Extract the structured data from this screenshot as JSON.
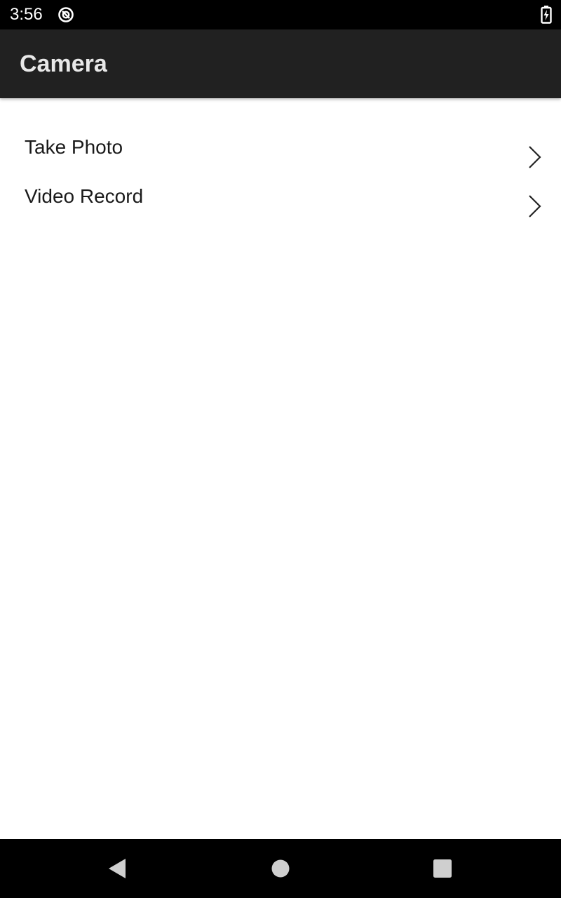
{
  "status_bar": {
    "time": "3:56",
    "icons": [
      "sync-icon",
      "battery-charging-icon"
    ]
  },
  "app_bar": {
    "title": "Camera",
    "background": "#212121"
  },
  "list": {
    "items": [
      {
        "label": "Take Photo",
        "icon": "chevron-right-icon"
      },
      {
        "label": "Video Record",
        "icon": "chevron-right-icon"
      }
    ]
  },
  "nav_bar": {
    "buttons": [
      "back-icon",
      "home-icon",
      "recents-icon"
    ]
  }
}
